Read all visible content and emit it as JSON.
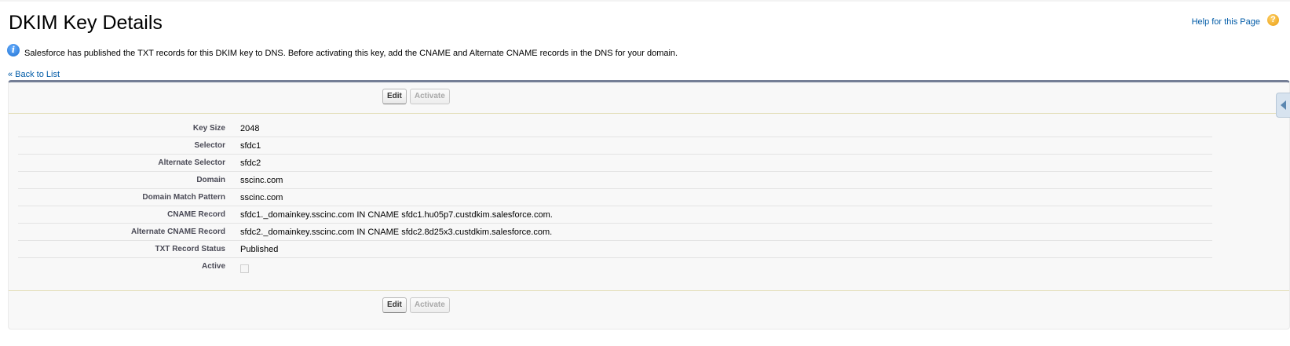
{
  "page": {
    "title": "DKIM Key Details",
    "help_link": "Help for this Page",
    "help_icon": "?",
    "info_icon": "i",
    "info_message": "Salesforce has published the TXT records for this DKIM key to DNS. Before activating this key, add the CNAME and Alternate CNAME records in the DNS for your domain.",
    "back_link": "« Back to List"
  },
  "buttons": {
    "edit": "Edit",
    "activate": "Activate"
  },
  "fields": [
    {
      "label": "Key Size",
      "value": "2048"
    },
    {
      "label": "Selector",
      "value": "sfdc1"
    },
    {
      "label": "Alternate Selector",
      "value": "sfdc2"
    },
    {
      "label": "Domain",
      "value": "sscinc.com"
    },
    {
      "label": "Domain Match Pattern",
      "value": "sscinc.com"
    },
    {
      "label": "CNAME Record",
      "value": "sfdc1._domainkey.sscinc.com IN CNAME sfdc1.hu05p7.custdkim.salesforce.com."
    },
    {
      "label": "Alternate CNAME Record",
      "value": "sfdc2._domainkey.sscinc.com IN CNAME sfdc2.8d25x3.custdkim.salesforce.com."
    },
    {
      "label": "TXT Record Status",
      "value": "Published"
    },
    {
      "label": "Active",
      "checked": false
    }
  ],
  "colors": {
    "link": "#015ba7",
    "panel_top_border": "#747e96",
    "label_text": "#4a4a56"
  }
}
